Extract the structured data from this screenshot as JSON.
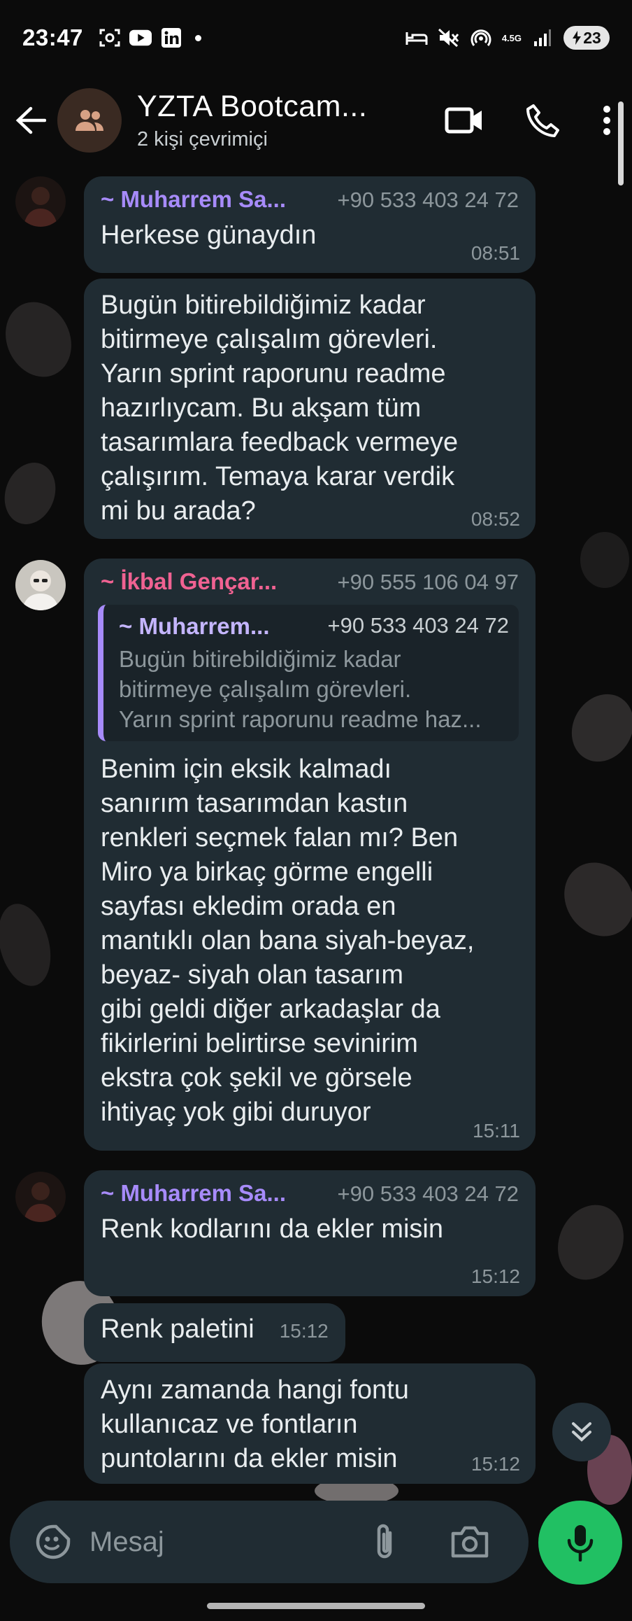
{
  "status_bar": {
    "time": "23:47",
    "network_label": "4.5G",
    "battery": "23",
    "icons_left": [
      "screenshot-icon",
      "youtube-icon",
      "linkedin-icon",
      "notification-dot"
    ],
    "icons_right": [
      "bed-alarm-icon",
      "mute-icon",
      "hotspot-icon",
      "signal-icon",
      "battery-icon"
    ]
  },
  "header": {
    "title": "YZTA Bootcam...",
    "subtitle": "2 kişi çevrimiçi"
  },
  "messages": [
    {
      "sender": "~ Muharrem Sa...",
      "phone": "+90 533 403 24 72",
      "text": "Herkese günaydın",
      "time": "08:51"
    },
    {
      "text": "Bugün bitirebildiğimiz kadar\nbitirmeye çalışalım görevleri.\nYarın sprint raporunu readme\nhazırlıycam. Bu akşam tüm\ntasarımlara feedback vermeye\nçalışırım. Temaya karar verdik\nmi bu arada?",
      "time": "08:52"
    },
    {
      "sender": "~ İkbal Gençar...",
      "phone": "+90 555 106 04 97",
      "quote": {
        "sender": "~ Muharrem...",
        "phone": "+90 533 403 24 72",
        "text": "Bugün bitirebildiğimiz kadar\nbitirmeye çalışalım görevleri.\nYarın sprint raporunu readme haz..."
      },
      "text": "Benim için eksik kalmadı\nsanırım tasarımdan kastın\nrenkleri seçmek  falan mı? Ben\nMiro ya birkaç görme engelli\nsayfası ekledim orada en\nmantıklı olan bana siyah-beyaz,\nbeyaz- siyah olan tasarım\ngibi geldi diğer arkadaşlar da\nfikirlerini belirtirse sevinirim\nekstra çok şekil ve görsele\nihtiyaç yok gibi duruyor",
      "time": "15:11"
    },
    {
      "sender": "~ Muharrem Sa...",
      "phone": "+90 533 403 24 72",
      "text": "Renk kodlarını da ekler misin",
      "time": "15:12"
    },
    {
      "text": "Renk paletini",
      "time": "15:12"
    },
    {
      "text": "Aynı zamanda hangi fontu\nkullanıcaz ve fontların\npuntolarını da ekler misin",
      "time": "15:12"
    }
  ],
  "composer": {
    "placeholder": "Mesaj"
  },
  "colors": {
    "background": "#0b0b0b",
    "bubble": "#202c33",
    "sender_muharrem": "#a78bfa",
    "sender_ikbal": "#f06292",
    "accent_green": "#21c063",
    "meta_text": "#8d979c"
  }
}
